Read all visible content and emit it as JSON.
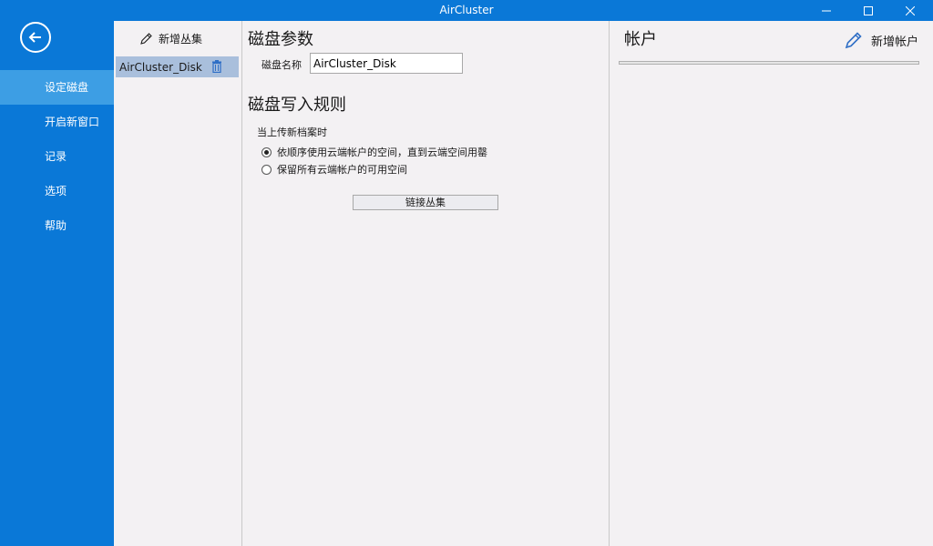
{
  "window": {
    "title": "AirCluster"
  },
  "nav": {
    "items": [
      {
        "label": "设定磁盘",
        "active": true
      },
      {
        "label": "开启新窗口",
        "active": false
      },
      {
        "label": "记录",
        "active": false
      },
      {
        "label": "选项",
        "active": false
      },
      {
        "label": "帮助",
        "active": false
      }
    ]
  },
  "clusters": {
    "add_label": "新增丛集",
    "items": [
      {
        "name": "AirCluster_Disk"
      }
    ]
  },
  "disk": {
    "params_title": "磁盘参数",
    "name_label": "磁盘名称",
    "name_value": "AirCluster_Disk",
    "rules_title": "磁盘写入规则",
    "upload_label": "当上传新档案时",
    "options": [
      {
        "label": "依顺序使用云端帐户的空间，直到云端空间用罄",
        "selected": true
      },
      {
        "label": "保留所有云端帐户的可用空间",
        "selected": false
      }
    ],
    "link_button": "链接丛集"
  },
  "accounts": {
    "title": "帐户",
    "add_label": "新增帐户"
  },
  "colors": {
    "accent": "#0a78d7",
    "nav_active": "#3d9ee4",
    "selection": "#a9bfdc"
  }
}
